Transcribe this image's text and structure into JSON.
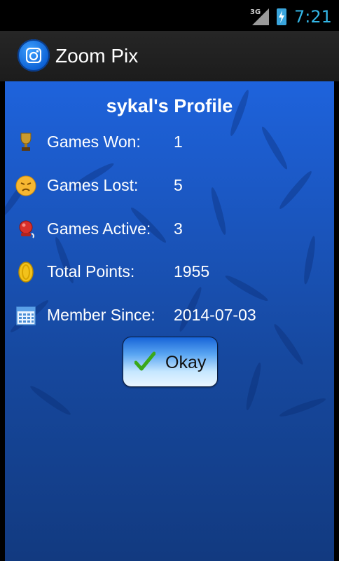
{
  "status_bar": {
    "network": "3G",
    "time": "7:21"
  },
  "action_bar": {
    "app_title": "Zoom Pix",
    "app_icon": "camera-icon"
  },
  "profile": {
    "title": "sykal's Profile",
    "stats": [
      {
        "icon": "trophy-icon",
        "label": "Games Won:",
        "value": "1"
      },
      {
        "icon": "sad-face-icon",
        "label": "Games Lost:",
        "value": "5"
      },
      {
        "icon": "alarm-bell-icon",
        "label": "Games Active:",
        "value": "3"
      },
      {
        "icon": "coin-icon",
        "label": "Total Points:",
        "value": "1955"
      },
      {
        "icon": "calendar-icon",
        "label": "Member Since:",
        "value": "2014-07-03"
      }
    ]
  },
  "okay_button": {
    "label": "Okay",
    "icon": "checkmark-icon"
  },
  "colors": {
    "accent": "#33b5e5",
    "background_top": "#1e63dc",
    "background_bottom": "#123a80"
  }
}
